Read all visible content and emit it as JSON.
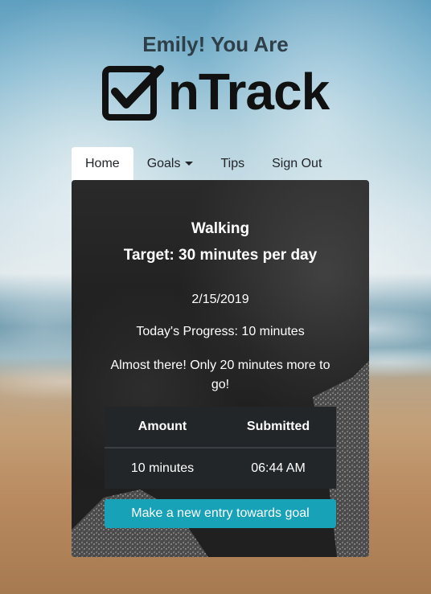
{
  "header": {
    "greeting": "Emily! You Are",
    "brand_text": "nTrack",
    "brand_icon": "checkbox-icon"
  },
  "nav": {
    "items": [
      {
        "label": "Home",
        "active": true
      },
      {
        "label": "Goals",
        "has_dropdown": true
      },
      {
        "label": "Tips"
      },
      {
        "label": "Sign Out"
      }
    ]
  },
  "goal": {
    "title": "Walking",
    "target": "Target: 30 minutes per day",
    "date": "2/15/2019",
    "progress": "Today's Progress: 10 minutes",
    "message": "Almost there! Only 20 minutes more to go!"
  },
  "entries": {
    "headers": [
      "Amount",
      "Submitted"
    ],
    "rows": [
      [
        "10 minutes",
        "06:44 AM"
      ]
    ]
  },
  "actions": {
    "new_entry_label": "Make a new entry towards goal"
  },
  "colors": {
    "accent": "#17a2b8",
    "card_bg": "#222222",
    "table_bg": "#222629"
  }
}
